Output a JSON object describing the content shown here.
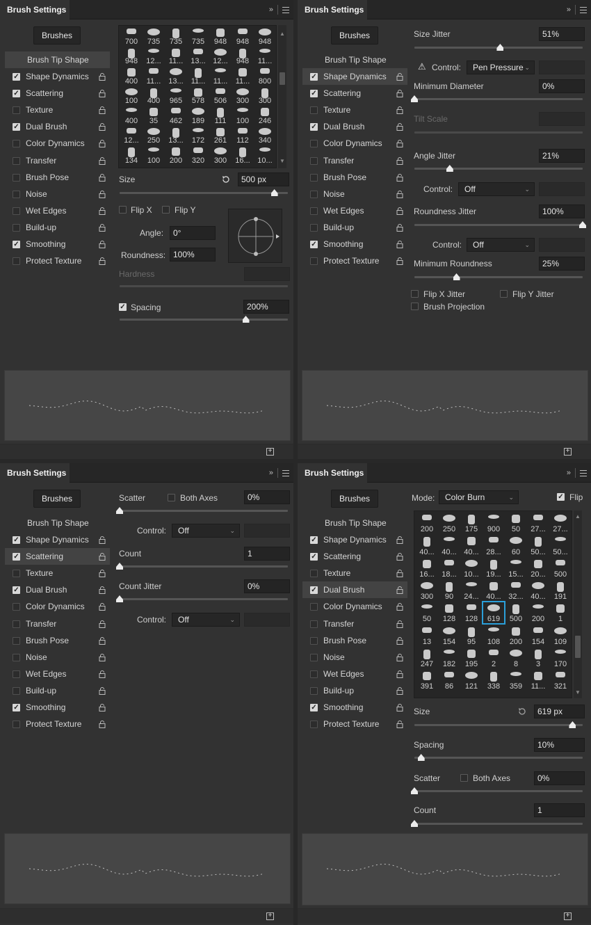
{
  "common": {
    "tab_title": "Brush Settings",
    "collapse_glyph": "»",
    "brushes_button": "Brushes",
    "sidebar": [
      {
        "label": "Brush Tip Shape",
        "checkbox": false,
        "lock": false
      },
      {
        "label": "Shape Dynamics",
        "checkbox": true
      },
      {
        "label": "Scattering",
        "checkbox": true
      },
      {
        "label": "Texture",
        "checkbox": false
      },
      {
        "label": "Dual Brush",
        "checkbox": true
      },
      {
        "label": "Color Dynamics",
        "checkbox": false
      },
      {
        "label": "Transfer",
        "checkbox": false
      },
      {
        "label": "Brush Pose",
        "checkbox": false
      },
      {
        "label": "Noise",
        "checkbox": false
      },
      {
        "label": "Wet Edges",
        "checkbox": false
      },
      {
        "label": "Build-up",
        "checkbox": false
      },
      {
        "label": "Smoothing",
        "checkbox": true
      },
      {
        "label": "Protect Texture",
        "checkbox": false
      }
    ],
    "new_brush_icon": "new-brush-icon",
    "lock_icon": "lock-icon"
  },
  "p1": {
    "selected_item": 0,
    "grid_rows": [
      [
        "700",
        "735",
        "735",
        "735",
        "948",
        "948",
        "948"
      ],
      [
        "948",
        "12...",
        "11...",
        "13...",
        "12...",
        "948",
        "11..."
      ],
      [
        "400",
        "11...",
        "13...",
        "11...",
        "11...",
        "11...",
        "800"
      ],
      [
        "100",
        "400",
        "965",
        "578",
        "506",
        "300",
        "300"
      ],
      [
        "400",
        "35",
        "462",
        "189",
        "111",
        "100",
        "246"
      ],
      [
        "12...",
        "250",
        "13...",
        "172",
        "261",
        "112",
        "340"
      ],
      [
        "134",
        "100",
        "200",
        "320",
        "300",
        "16...",
        "10..."
      ]
    ],
    "size_label": "Size",
    "size_value": "500 px",
    "size_slider": 0.92,
    "flip_x": "Flip X",
    "flip_y": "Flip Y",
    "angle_label": "Angle:",
    "angle_value": "0°",
    "roundness_label": "Roundness:",
    "roundness_value": "100%",
    "hardness_label": "Hardness",
    "spacing_label": "Spacing",
    "spacing_value": "200%",
    "spacing_slider": 0.75
  },
  "p2": {
    "selected_item": 1,
    "size_jitter_label": "Size Jitter",
    "size_jitter_value": "51%",
    "size_jitter_slider": 0.51,
    "control_label": "Control:",
    "control_value": "Pen Pressure",
    "min_diameter_label": "Minimum Diameter",
    "min_diameter_value": "0%",
    "tilt_scale_label": "Tilt Scale",
    "angle_jitter_label": "Angle Jitter",
    "angle_jitter_value": "21%",
    "angle_jitter_slider": 0.21,
    "angle_control_value": "Off",
    "roundness_jitter_label": "Roundness Jitter",
    "roundness_jitter_value": "100%",
    "roundness_control_value": "Off",
    "min_roundness_label": "Minimum Roundness",
    "min_roundness_value": "25%",
    "min_roundness_slider": 0.25,
    "flip_x_jitter": "Flip X Jitter",
    "flip_y_jitter": "Flip Y Jitter",
    "brush_projection": "Brush Projection"
  },
  "p3": {
    "selected_item": 2,
    "scatter_label": "Scatter",
    "both_axes": "Both Axes",
    "scatter_value": "0%",
    "control_label": "Control:",
    "control_value": "Off",
    "count_label": "Count",
    "count_value": "1",
    "count_jitter_label": "Count Jitter",
    "count_jitter_value": "0%",
    "count_jitter_control": "Off"
  },
  "p4": {
    "selected_item": 4,
    "mode_label": "Mode:",
    "mode_value": "Color Burn",
    "flip_label": "Flip",
    "grid_rows": [
      [
        "200",
        "250",
        "175",
        "900",
        "50",
        "27...",
        "27..."
      ],
      [
        "40...",
        "40...",
        "40...",
        "28...",
        "60",
        "50...",
        "50..."
      ],
      [
        "16...",
        "18...",
        "10...",
        "19...",
        "15...",
        "20...",
        "500"
      ],
      [
        "300",
        "90",
        "24...",
        "40...",
        "32...",
        "40...",
        "191"
      ],
      [
        "50",
        "128",
        "128",
        "619",
        "500",
        "200",
        "1"
      ],
      [
        "13",
        "154",
        "95",
        "108",
        "200",
        "154",
        "109"
      ],
      [
        "247",
        "182",
        "195",
        "2",
        "8",
        "3",
        "170"
      ],
      [
        "391",
        "86",
        "121",
        "338",
        "359",
        "11...",
        "321"
      ]
    ],
    "selected_cell": [
      4,
      3
    ],
    "size_label": "Size",
    "size_value": "619 px",
    "size_slider": 0.94,
    "spacing_label": "Spacing",
    "spacing_value": "10%",
    "spacing_slider": 0.04,
    "scatter_label": "Scatter",
    "both_axes": "Both Axes",
    "scatter_value": "0%",
    "count_label": "Count",
    "count_value": "1"
  }
}
